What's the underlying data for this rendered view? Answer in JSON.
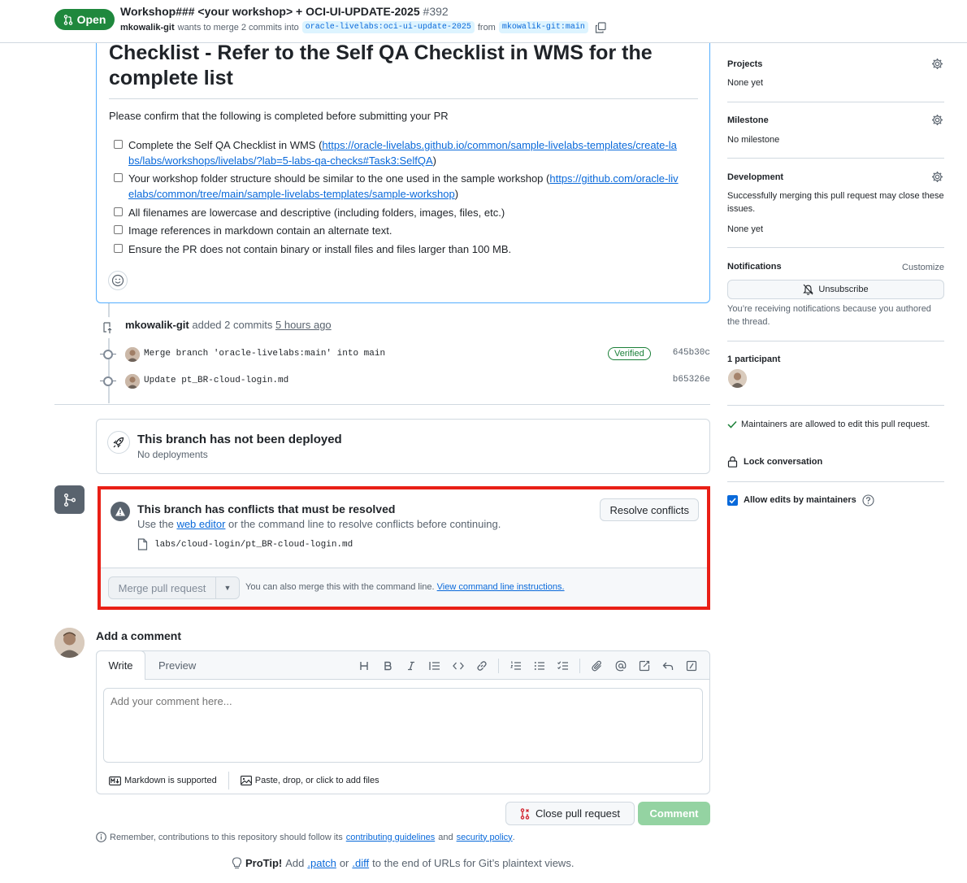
{
  "header": {
    "status": "Open",
    "title": "Workshop### <your workshop> + OCI-UI-UPDATE-2025",
    "number": "#392",
    "author": "mkowalik-git",
    "merge_text": "wants to merge 2 commits into",
    "base_branch": "oracle-livelabs:oci-ui-update-2025",
    "from_text": "from",
    "head_branch": "mkowalik-git:main"
  },
  "description": {
    "heading": "Checklist - Refer to the Self QA Checklist in WMS for the complete list",
    "intro": "Please confirm that the following is completed before submitting your PR",
    "items": [
      {
        "text": "Complete the Self QA Checklist in WMS (",
        "link": "https://oracle-livelabs.github.io/common/sample-livelabs-templates/create-labs/labs/workshops/livelabs/?lab=5-labs-qa-checks#Task3:SelfQA",
        "suffix": ")"
      },
      {
        "text": "Your workshop folder structure should be similar to the one used in the sample workshop (",
        "link": "https://github.com/oracle-livelabs/common/tree/main/sample-livelabs-templates/sample-workshop",
        "suffix": ")"
      },
      {
        "text": "All filenames are lowercase and descriptive (including folders, images, files, etc.)"
      },
      {
        "text": "Image references in markdown contain an alternate text."
      },
      {
        "text": "Ensure the PR does not contain binary or install files and files larger than 100 MB."
      }
    ]
  },
  "commits": {
    "author": "mkowalik-git",
    "added_text": "added 2 commits",
    "time": "5 hours ago",
    "list": [
      {
        "message": "Merge branch 'oracle-livelabs:main' into main",
        "verified": "Verified",
        "sha": "645b30c"
      },
      {
        "message": "Update pt_BR-cloud-login.md",
        "sha": "b65326e"
      }
    ]
  },
  "deploy": {
    "title": "This branch has not been deployed",
    "subtitle": "No deployments"
  },
  "merge": {
    "title": "This branch has conflicts that must be resolved",
    "sub_pre": "Use the",
    "sub_link": "web editor",
    "sub_post": "or the command line to resolve conflicts before continuing.",
    "file": "labs/cloud-login/pt_BR-cloud-login.md",
    "resolve_label": "Resolve conflicts",
    "merge_label": "Merge pull request",
    "note": "You can also merge this with the command line.",
    "note_link": "View command line instructions."
  },
  "comment": {
    "heading": "Add a comment",
    "tab_write": "Write",
    "tab_preview": "Preview",
    "placeholder": "Add your comment here...",
    "markdown": "Markdown is supported",
    "attach": "Paste, drop, or click to add files",
    "close_label": "Close pull request",
    "comment_label": "Comment"
  },
  "footer": {
    "remember_pre": "Remember, contributions to this repository should follow its",
    "guidelines": "contributing guidelines",
    "and": "and",
    "policy": "security policy",
    "period": ".",
    "protip_label": "ProTip!",
    "protip_add": "Add",
    "patch": ".patch",
    "or": "or",
    "diff": ".diff",
    "protip_end": "to the end of URLs for Git’s plaintext views."
  },
  "sidebar": {
    "projects": {
      "label": "Projects",
      "value": "None yet"
    },
    "milestone": {
      "label": "Milestone",
      "value": "No milestone"
    },
    "development": {
      "label": "Development",
      "text": "Successfully merging this pull request may close these issues.",
      "value": "None yet"
    },
    "notifications": {
      "label": "Notifications",
      "customize": "Customize",
      "button": "Unsubscribe",
      "reason": "You’re receiving notifications because you authored the thread."
    },
    "participants": {
      "label": "1 participant"
    },
    "maintainers_note": "Maintainers are allowed to edit this pull request.",
    "lock": "Lock conversation",
    "allow_edits": "Allow edits by maintainers"
  },
  "colors": {
    "open_green": "#1f883d",
    "highlight_red": "#e91f16",
    "link_blue": "#0969da"
  }
}
